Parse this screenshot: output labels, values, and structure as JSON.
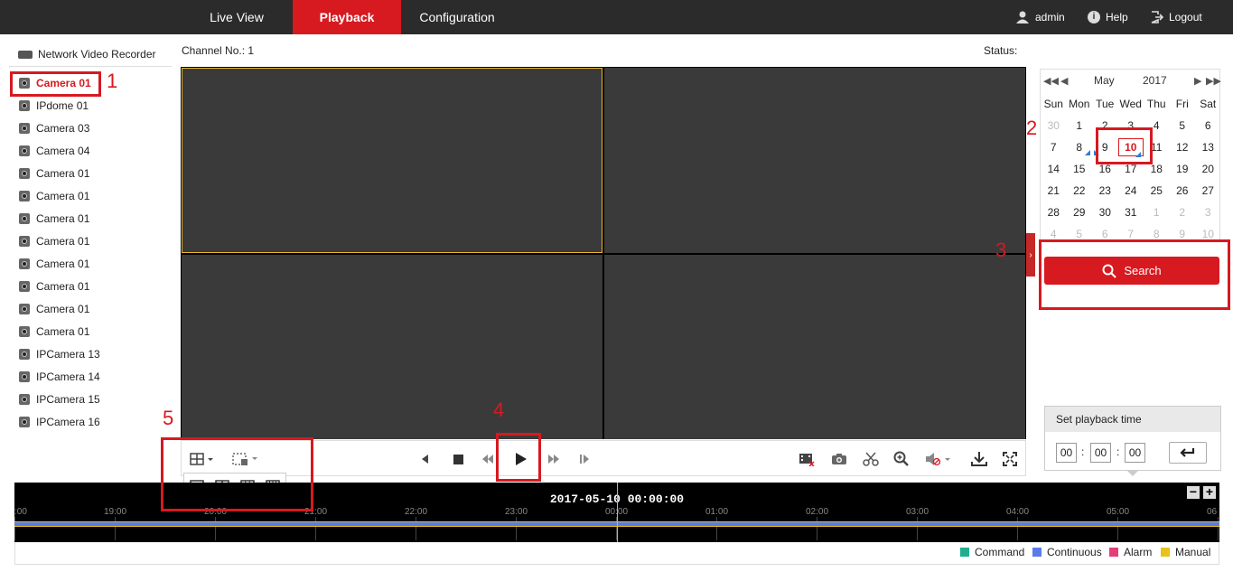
{
  "nav": {
    "tabs": [
      {
        "label": "Live View"
      },
      {
        "label": "Playback",
        "active": true
      },
      {
        "label": "Configuration"
      }
    ],
    "user": "admin",
    "help": "Help",
    "logout": "Logout"
  },
  "sidebar": {
    "root": "Network Video Recorder",
    "cameras": [
      "Camera 01",
      "IPdome 01",
      "Camera 03",
      "Camera 04",
      "Camera 01",
      "Camera 01",
      "Camera 01",
      "Camera 01",
      "Camera 01",
      "Camera 01",
      "Camera 01",
      "Camera 01",
      "IPCamera 13",
      "IPCamera 14",
      "IPCamera 15",
      "IPCamera 16"
    ],
    "selected_index": 0
  },
  "header": {
    "channel": "Channel No.: 1",
    "status": "Status:"
  },
  "calendar": {
    "month": "May",
    "year": "2017",
    "weekdays": [
      "Sun",
      "Mon",
      "Tue",
      "Wed",
      "Thu",
      "Fri",
      "Sat"
    ],
    "weeks": [
      [
        "30",
        "1",
        "2",
        "3",
        "4",
        "5",
        "6"
      ],
      [
        "7",
        "8",
        "9",
        "10",
        "11",
        "12",
        "13"
      ],
      [
        "14",
        "15",
        "16",
        "17",
        "18",
        "19",
        "20"
      ],
      [
        "21",
        "22",
        "23",
        "24",
        "25",
        "26",
        "27"
      ],
      [
        "28",
        "29",
        "30",
        "31",
        "1",
        "2",
        "3"
      ],
      [
        "4",
        "5",
        "6",
        "7",
        "8",
        "9",
        "10"
      ]
    ],
    "selected": "10"
  },
  "search": {
    "label": "Search"
  },
  "playback_time": {
    "title": "Set playback time",
    "hh": "00",
    "mm": "00",
    "ss": "00"
  },
  "timeline": {
    "current": "2017-05-10 00:00:00",
    "labels": [
      ":00",
      "19:00",
      "20:00",
      "21:00",
      "22:00",
      "23:00",
      "00:00",
      "01:00",
      "02:00",
      "03:00",
      "04:00",
      "05:00",
      "06"
    ]
  },
  "legend": [
    {
      "label": "Command",
      "color": "#1fae8f"
    },
    {
      "label": "Continuous",
      "color": "#5b7be8"
    },
    {
      "label": "Alarm",
      "color": "#e43d7a"
    },
    {
      "label": "Manual",
      "color": "#e8c21a"
    }
  ],
  "annotations": [
    "1",
    "2",
    "3",
    "4",
    "5"
  ],
  "colors": {
    "accent": "#d71920",
    "topbar": "#2b2b2b"
  }
}
